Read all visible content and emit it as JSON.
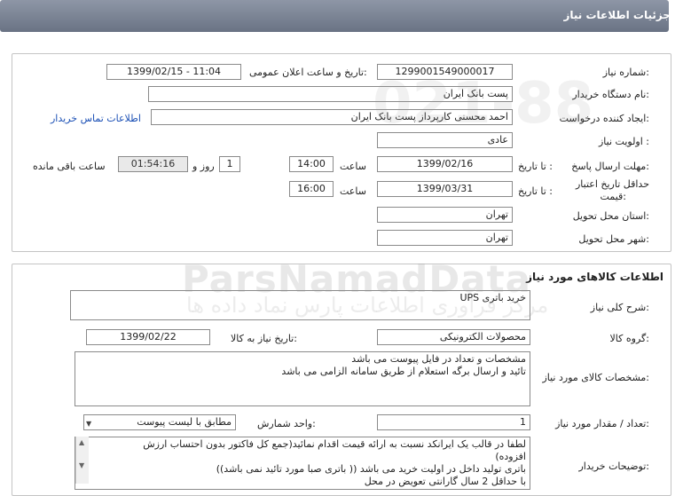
{
  "header": {
    "title": "جزئیات اطلاعات نیاز"
  },
  "request": {
    "need_number_label": "شماره نیاز:",
    "need_number": "1299001549000017",
    "announce_label": "تاریخ و ساعت اعلان عمومی:",
    "announce_value": "1399/02/15 - 11:04",
    "buyer_org_label": "نام دستگاه خریدار:",
    "buyer_org": "پست بانک ایران",
    "creator_label": "ایجاد کننده درخواست:",
    "creator": "احمد  محسنی کارپرداز پست بانک ایران",
    "contact_link": "اطلاعات تماس خریدار",
    "priority_label": "اولویت نیاز :",
    "priority": "عادی",
    "deadline_label": "مهلت ارسال پاسخ:",
    "deadline_to": "تا تاریخ :",
    "deadline_date": "1399/02/16",
    "time_label": "ساعت",
    "deadline_time": "14:00",
    "days": "1",
    "days_label": "روز و",
    "remaining_time": "01:54:16",
    "remaining_label": "ساعت باقی مانده",
    "validity_label_1": "حداقل تاریخ اعتبار",
    "validity_label_2": "قیمت:",
    "validity_to": "تا تاریخ :",
    "validity_date": "1399/03/31",
    "validity_time_label": "ساعت",
    "validity_time": "16:00",
    "province_label": "استان محل تحویل:",
    "province": "تهران",
    "city_label": "شهر محل تحویل:",
    "city": "تهران"
  },
  "goods": {
    "section_title": "اطلاعات کالاهای مورد نیاز",
    "summary_label": "شرح کلی نیاز:",
    "summary": "خرید باتری UPS",
    "group_label": "گروه کالا:",
    "group": "محصولات الکترونیکی",
    "need_date_label": "تاریخ نیاز به کالا:",
    "need_date": "1399/02/22",
    "specs_label": "مشخصات کالای مورد نیاز:",
    "specs_lines": [
      "مشخصات و تعداد در فایل پیوست می باشد",
      "تائید و ارسال برگه استعلام از طریق سامانه الزامی می باشد"
    ],
    "qty_label": "تعداد / مقدار مورد نیاز:",
    "qty": "1",
    "unit_label": "واحد شمارش:",
    "unit": "مطابق با لیست پیوست",
    "buyer_notes_label": "توضیحات خریدار:",
    "buyer_notes_lines": [
      "لطفا در قالب یک ایرانکد نسبت به ارائه قیمت اقدام نمائید(جمع کل فاکتور بدون احتساب ارزش",
      "افزوده)",
      "باتری تولید داخل در اولیت خرید می باشد (( باتری صبا مورد تائید نمی باشد))",
      "با حداقل 2 سال گارانتی تعویض در محل"
    ]
  },
  "watermark": {
    "brand": "ParsNamadData",
    "tagline": "مرکز فرآوری اطلاعات پارس نماد داده ها",
    "digits": "021-88"
  },
  "icons": {
    "scroll_up": "scroll-up-icon",
    "scroll_down": "scroll-down-icon",
    "dropdown": "chevron-down-icon"
  }
}
